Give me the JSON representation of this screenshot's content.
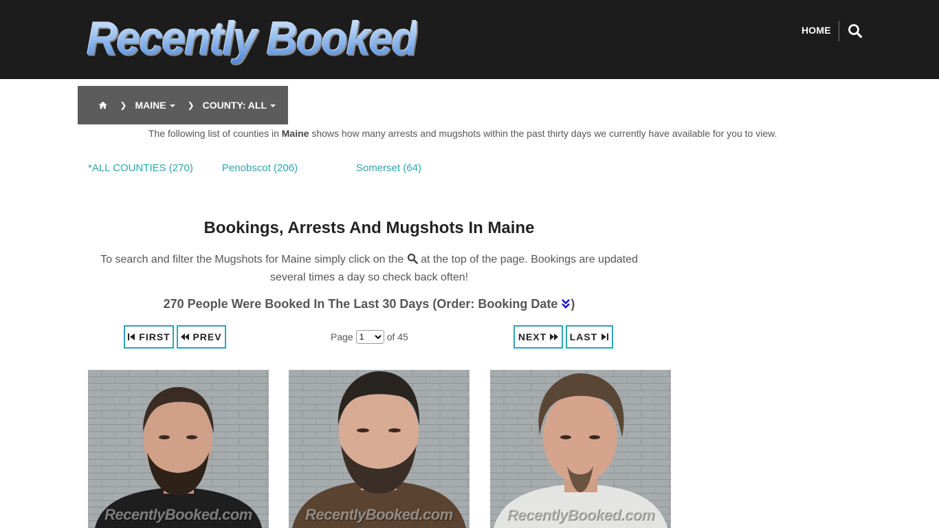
{
  "header": {
    "logo_text": "Recently Booked",
    "nav_home": "HOME"
  },
  "breadcrumb": {
    "state": "MAINE",
    "county": "COUNTY: ALL"
  },
  "intro": {
    "before": "The following list of counties in ",
    "state": "Maine",
    "after": " shows how many arrests and mugshots within the past thirty days we currently have available for you to view."
  },
  "counties": [
    {
      "label": "*ALL COUNTIES (270)"
    },
    {
      "label": "Penobscot (206)"
    },
    {
      "label": "Somerset (64)"
    }
  ],
  "main": {
    "heading": "Bookings, Arrests And Mugshots In Maine",
    "para_before": "To search and filter the Mugshots for Maine simply click on the",
    "para_after": "at the top of the page. Bookings are updated several times a day so check back often!",
    "count_text": "270 People Were Booked In The Last 30 Days (Order: Booking Date",
    "count_close": ")"
  },
  "pagination": {
    "first": "FIRST",
    "prev": "PREV",
    "next": "NEXT",
    "last": "LAST",
    "page_label": "Page",
    "page_value": "1",
    "of_label": "of 45"
  },
  "mugshots": [
    {
      "watermark": "RecentlyBooked.com",
      "shirt": "#1e1e1e",
      "hair": "#3a2c22",
      "beard": "#2e2118"
    },
    {
      "watermark": "RecentlyBooked.com",
      "shirt": "#5a4330",
      "hair": "#2a2420",
      "beard": "#3a2e26"
    },
    {
      "watermark": "RecentlyBooked.com",
      "shirt": "#e4e4e2",
      "hair": "#5a4634",
      "beard": "#6a5240"
    }
  ],
  "colors": {
    "header_bg": "#1c1c1c",
    "breadcrumb_bg": "#5c5c5c",
    "accent_teal": "#2aa6b0",
    "sort_icon": "#1a1ad6"
  }
}
